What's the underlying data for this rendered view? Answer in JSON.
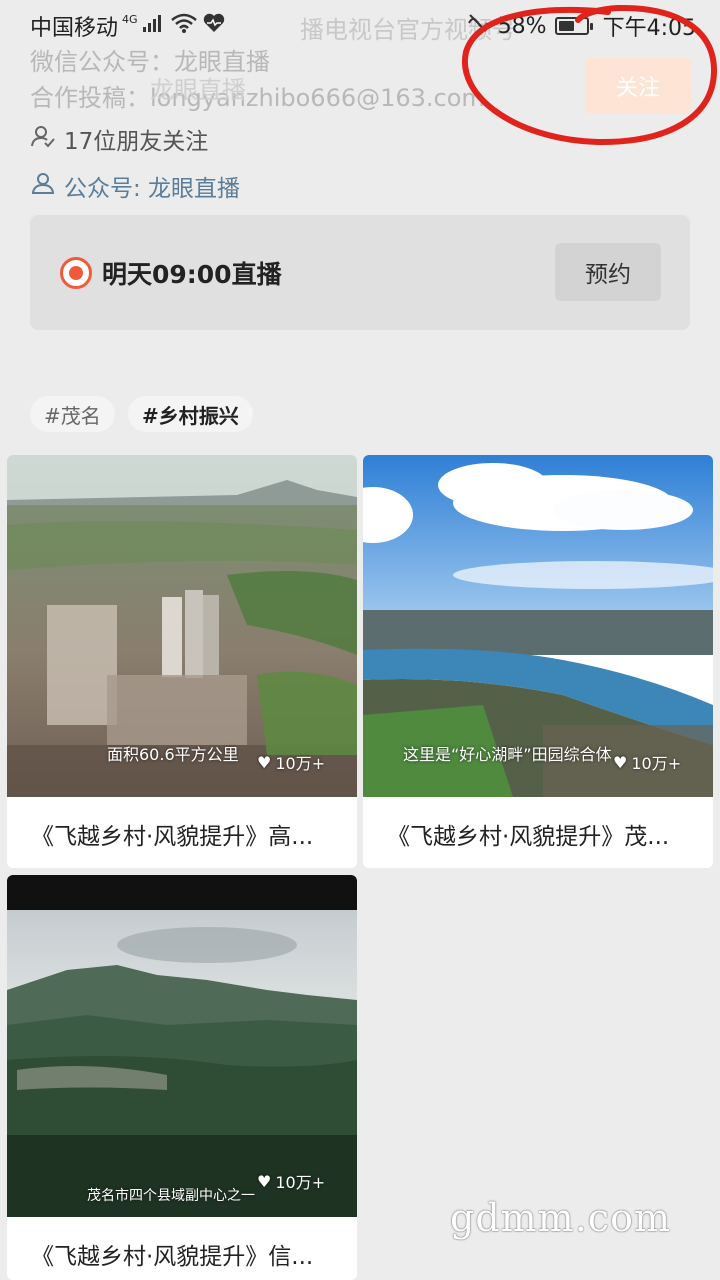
{
  "status_bar": {
    "carrier": "中国移动",
    "network": "4G",
    "battery_percent": "58%",
    "battery_level": 0.58,
    "time": "下午4:05"
  },
  "header": {
    "faded_title": "播电视台官方视频号",
    "wechat_line": "微信公众号：龙眼直播",
    "submit_line": "合作投稿：longyanzhibo666@163.com",
    "avatar_label": "龙眼直播",
    "follow_label": "关注",
    "friends_text": "17位朋友关注",
    "account_text": "公众号: 龙眼直播"
  },
  "live": {
    "text": "明天09:00直播",
    "reserve_label": "预约"
  },
  "tags": [
    "#茂名",
    "#乡村振兴"
  ],
  "videos": [
    {
      "caption": "面积60.6平方公里",
      "likes": "10万+",
      "title": "《飞越乡村·风貌提升》高..."
    },
    {
      "caption": "这里是“好心湖畔”田园综合体",
      "likes": "10万+",
      "title": "《飞越乡村·风貌提升》茂..."
    },
    {
      "caption": "茂名市四个县域副中心之一",
      "likes": "10万+",
      "title": "《飞越乡村·风貌提升》信..."
    }
  ],
  "watermark": "gdmm.com",
  "colors": {
    "live_red": "#f05a3a",
    "account_blue": "#5a7d9a",
    "annotation_red": "#e0241c"
  }
}
